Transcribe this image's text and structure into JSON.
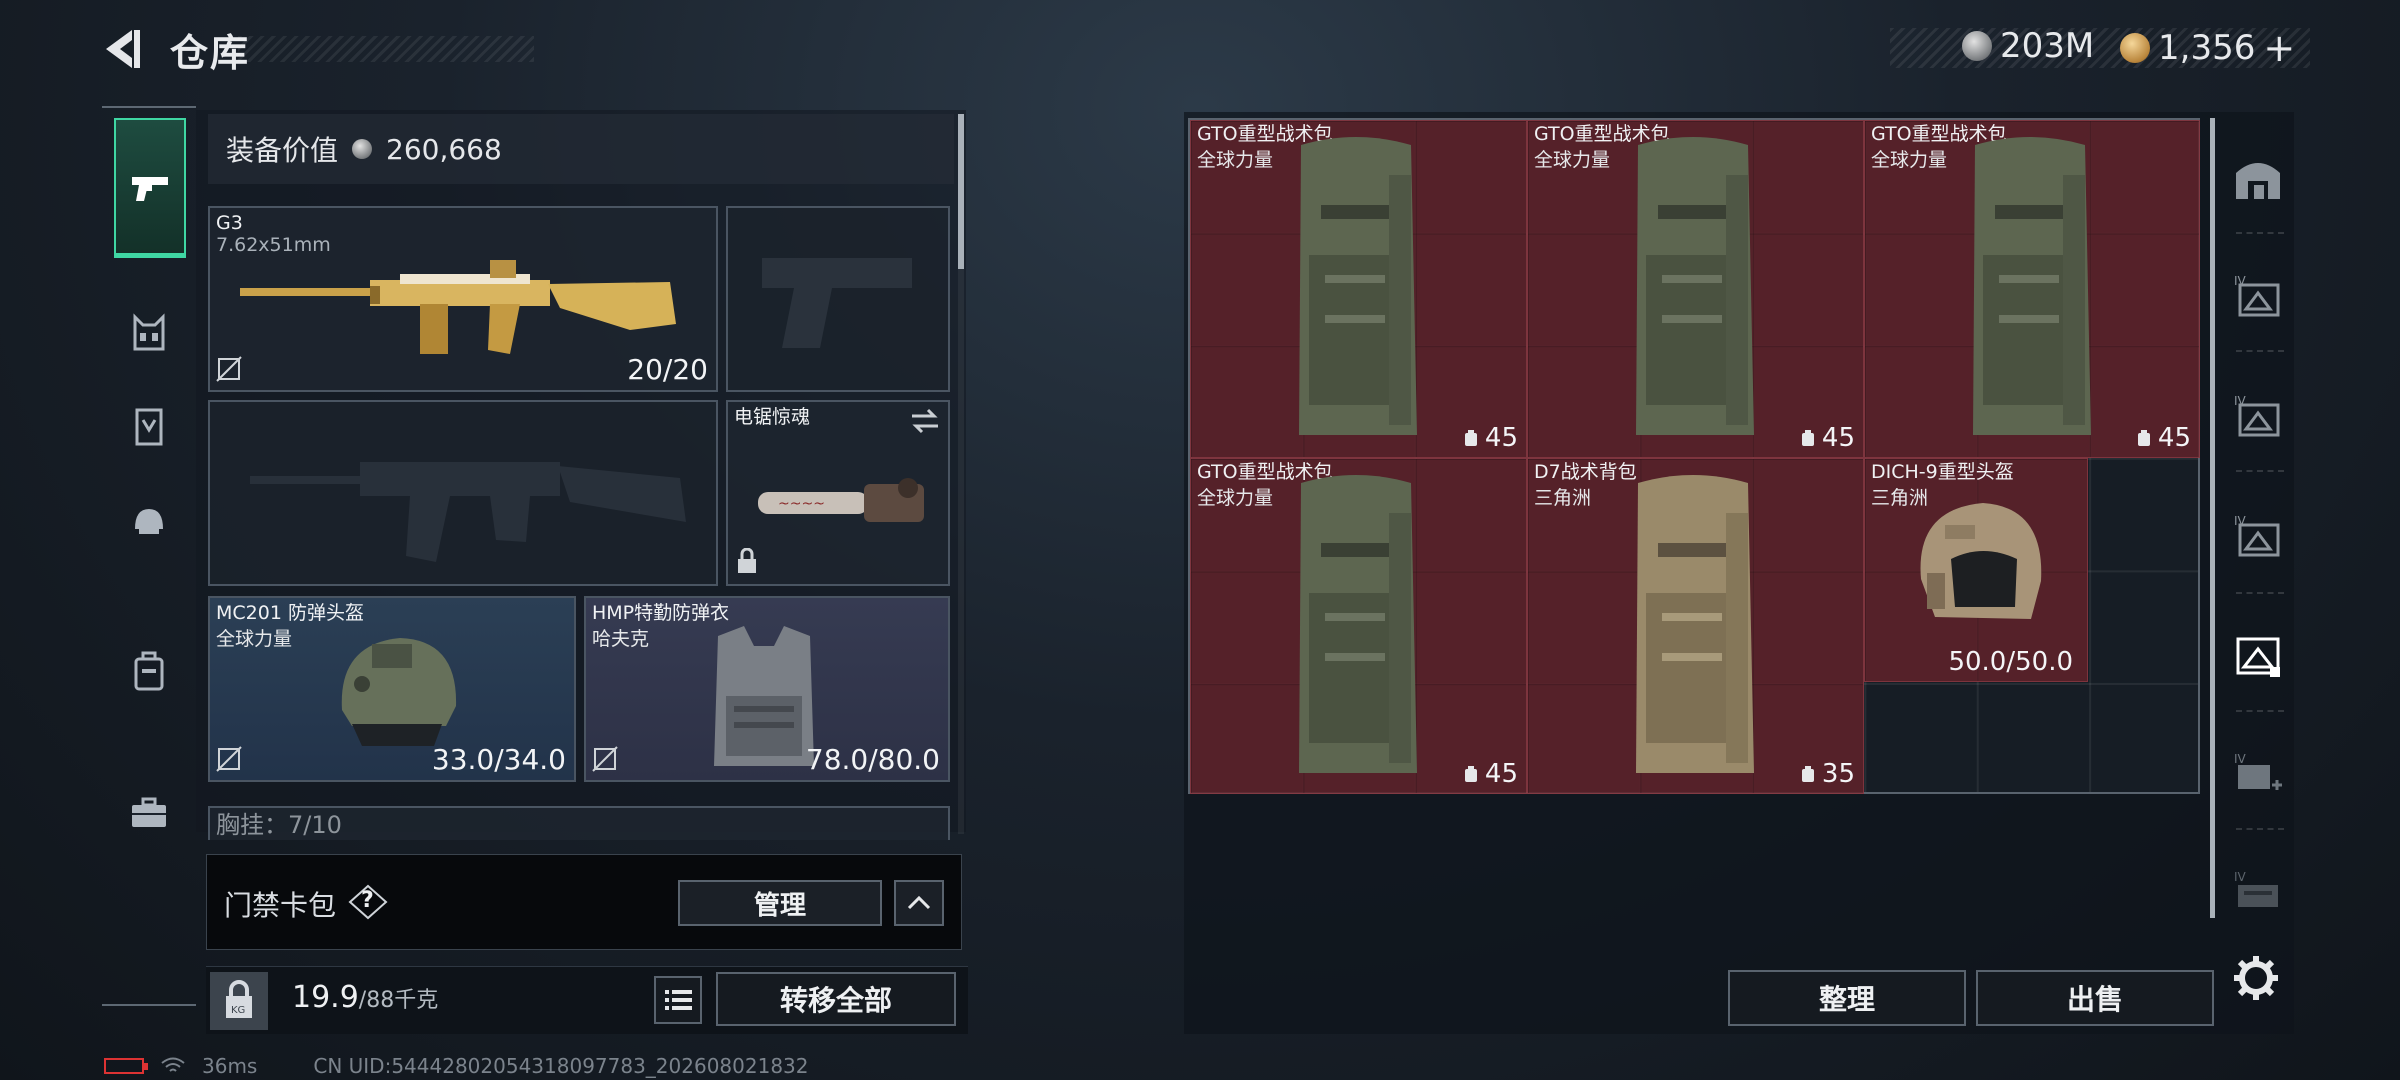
{
  "header": {
    "title": "仓库",
    "currency_silver": "203M",
    "currency_gold": "1,356",
    "add_symbol": "+"
  },
  "loadout": {
    "equip_value_label": "装备价值",
    "equip_value": "260,668",
    "primary": {
      "name": "G3",
      "caliber": "7.62x51mm",
      "ammo": "20/20"
    },
    "melee": {
      "name": "电锯惊魂"
    },
    "helmet": {
      "name": "MC201 防弹头盔",
      "brand": "全球力量",
      "durability": "33.0/34.0"
    },
    "armor": {
      "name": "HMP特勤防弹衣",
      "brand": "哈夫克",
      "durability": "78.0/80.0"
    },
    "chest_rig_peek": "胸挂：7/10",
    "keycard_label": "门禁卡包",
    "help": "?",
    "manage_label": "管理",
    "weight_value": "19.9",
    "weight_max": "/88千克",
    "transfer_all_label": "转移全部"
  },
  "status": {
    "ping": "36ms",
    "uid": "CN UID:54442802054318097783_202608021832"
  },
  "storage": {
    "items": [
      {
        "name": "GTO重型战术包",
        "sub": "全球力量",
        "capacity": "45",
        "kind": "backpack-green"
      },
      {
        "name": "GTO重型战术包",
        "sub": "全球力量",
        "capacity": "45",
        "kind": "backpack-green"
      },
      {
        "name": "GTO重型战术包",
        "sub": "全球力量",
        "capacity": "45",
        "kind": "backpack-green"
      },
      {
        "name": "GTO重型战术包",
        "sub": "全球力量",
        "capacity": "45",
        "kind": "backpack-green"
      },
      {
        "name": "D7战术背包",
        "sub": "三角洲",
        "capacity": "35",
        "kind": "backpack-tan"
      },
      {
        "name": "DICH-9重型头盔",
        "sub": "三角洲",
        "durability": "50.0/50.0",
        "kind": "helmet"
      }
    ],
    "sort_label": "整理",
    "sell_label": "出售"
  },
  "colors": {
    "accent": "#3fd7a3",
    "item_bg": "#60222a",
    "battery_low": "#dd3333"
  }
}
